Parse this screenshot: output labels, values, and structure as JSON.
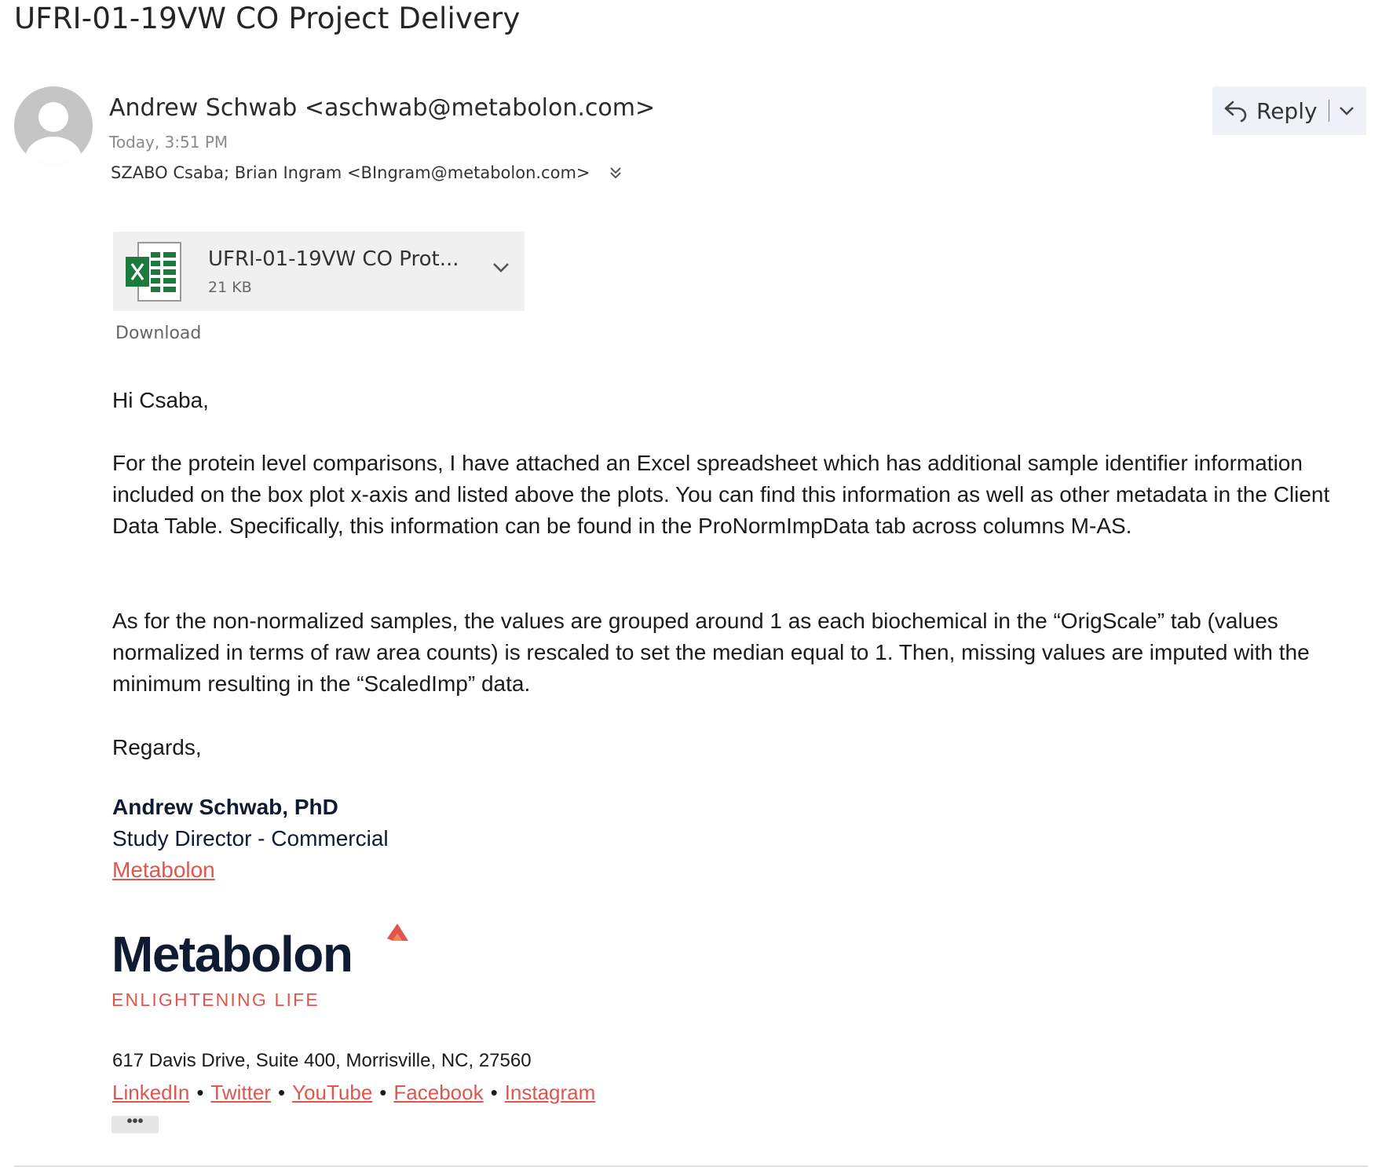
{
  "email": {
    "subject": "UFRI-01-19VW CO Project Delivery",
    "sender": "Andrew Schwab <aschwab@metabolon.com>",
    "date": "Today, 3:51 PM",
    "recipients": "SZABO Csaba;  Brian Ingram <BIngram@metabolon.com>",
    "reply_label": "Reply"
  },
  "attachment": {
    "name": "UFRI-01-19VW CO Prot...",
    "size": "21 KB",
    "download_label": "Download"
  },
  "body": {
    "greeting": "Hi Csaba,",
    "paragraph1": "For the protein level comparisons, I have attached an Excel spreadsheet which has additional sample identifier information included on the box plot x-axis and listed above the plots. You can find this information as well as other metadata in the Client Data Table. Specifically, this information can be found in the ProNormImpData tab across columns M-AS.",
    "paragraph2": "As for the non-normalized samples, the values are grouped around 1 as each biochemical in the “OrigScale” tab (values normalized in terms of raw area counts) is rescaled to set the median equal to 1. Then, missing values are imputed with the minimum resulting in the “ScaledImp” data.",
    "regards": "Regards,"
  },
  "signature": {
    "name": "Andrew Schwab, PhD",
    "title": "Study Director - Commercial",
    "company_link": "Metabolon",
    "logo_text": "Metabolon",
    "logo_tagline": "ENLIGHTENING LIFE",
    "address": "617 Davis Drive, Suite 400, Morrisville, NC, 27560",
    "social": {
      "linkedin": "LinkedIn",
      "twitter": "Twitter",
      "youtube": "YouTube",
      "facebook": "Facebook",
      "instagram": "Instagram",
      "separator": "•"
    },
    "more_label": "•••"
  },
  "colors": {
    "link": "#e0554e",
    "signature_navy": "#0e1b33",
    "excel_green": "#1d7a3e"
  },
  "icons": [
    "avatar-icon",
    "expand-recipients-icon",
    "reply-icon",
    "chevron-down-icon",
    "excel-file-icon"
  ]
}
